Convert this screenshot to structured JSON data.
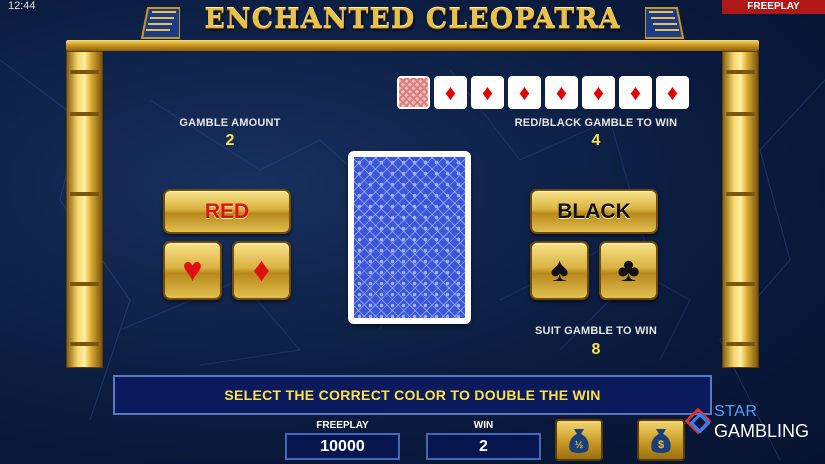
{
  "status_bar": {
    "time": "12:44",
    "mode": "FREEPLAY"
  },
  "title": "ENCHANTED CLEOPATRA",
  "history": {
    "cards": [
      "♦",
      "♦",
      "♦",
      "♦",
      "♦",
      "♦",
      "♦"
    ]
  },
  "gamble_amount": {
    "label": "GAMBLE AMOUNT",
    "value": "2"
  },
  "red_black_win": {
    "label": "RED/BLACK GAMBLE TO WIN",
    "value": "4"
  },
  "suit_win": {
    "label": "SUIT GAMBLE TO WIN",
    "value": "8"
  },
  "buttons": {
    "red": "RED",
    "black": "BLACK",
    "heart": "♥",
    "diamond": "♦",
    "spade": "♠",
    "club": "♣"
  },
  "message": "SELECT THE CORRECT COLOR TO DOUBLE THE WIN",
  "footer": {
    "freeplay_label": "FREEPLAY",
    "freeplay_value": "10000",
    "win_label": "WIN",
    "win_value": "2"
  },
  "icons": {
    "half_collect": "money-bag-half-icon",
    "collect": "money-bag-dollar-icon"
  },
  "watermark": {
    "line1": "STAR",
    "line2": "GAMBLING"
  },
  "colors": {
    "gold": "#e8c04a",
    "value_yellow": "#ffe24a",
    "red_suit": "#e01010",
    "badge_red": "#b01818"
  }
}
